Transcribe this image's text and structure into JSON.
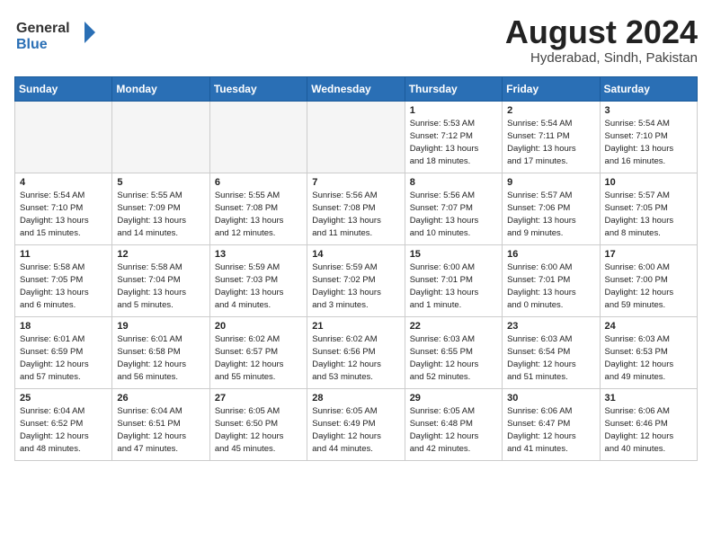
{
  "header": {
    "logo_general": "General",
    "logo_blue": "Blue",
    "month_year": "August 2024",
    "location": "Hyderabad, Sindh, Pakistan"
  },
  "weekdays": [
    "Sunday",
    "Monday",
    "Tuesday",
    "Wednesday",
    "Thursday",
    "Friday",
    "Saturday"
  ],
  "weeks": [
    [
      {
        "day": "",
        "empty": true
      },
      {
        "day": "",
        "empty": true
      },
      {
        "day": "",
        "empty": true
      },
      {
        "day": "",
        "empty": true
      },
      {
        "day": "1",
        "info": "Sunrise: 5:53 AM\nSunset: 7:12 PM\nDaylight: 13 hours\nand 18 minutes."
      },
      {
        "day": "2",
        "info": "Sunrise: 5:54 AM\nSunset: 7:11 PM\nDaylight: 13 hours\nand 17 minutes."
      },
      {
        "day": "3",
        "info": "Sunrise: 5:54 AM\nSunset: 7:10 PM\nDaylight: 13 hours\nand 16 minutes."
      }
    ],
    [
      {
        "day": "4",
        "info": "Sunrise: 5:54 AM\nSunset: 7:10 PM\nDaylight: 13 hours\nand 15 minutes."
      },
      {
        "day": "5",
        "info": "Sunrise: 5:55 AM\nSunset: 7:09 PM\nDaylight: 13 hours\nand 14 minutes."
      },
      {
        "day": "6",
        "info": "Sunrise: 5:55 AM\nSunset: 7:08 PM\nDaylight: 13 hours\nand 12 minutes."
      },
      {
        "day": "7",
        "info": "Sunrise: 5:56 AM\nSunset: 7:08 PM\nDaylight: 13 hours\nand 11 minutes."
      },
      {
        "day": "8",
        "info": "Sunrise: 5:56 AM\nSunset: 7:07 PM\nDaylight: 13 hours\nand 10 minutes."
      },
      {
        "day": "9",
        "info": "Sunrise: 5:57 AM\nSunset: 7:06 PM\nDaylight: 13 hours\nand 9 minutes."
      },
      {
        "day": "10",
        "info": "Sunrise: 5:57 AM\nSunset: 7:05 PM\nDaylight: 13 hours\nand 8 minutes."
      }
    ],
    [
      {
        "day": "11",
        "info": "Sunrise: 5:58 AM\nSunset: 7:05 PM\nDaylight: 13 hours\nand 6 minutes."
      },
      {
        "day": "12",
        "info": "Sunrise: 5:58 AM\nSunset: 7:04 PM\nDaylight: 13 hours\nand 5 minutes."
      },
      {
        "day": "13",
        "info": "Sunrise: 5:59 AM\nSunset: 7:03 PM\nDaylight: 13 hours\nand 4 minutes."
      },
      {
        "day": "14",
        "info": "Sunrise: 5:59 AM\nSunset: 7:02 PM\nDaylight: 13 hours\nand 3 minutes."
      },
      {
        "day": "15",
        "info": "Sunrise: 6:00 AM\nSunset: 7:01 PM\nDaylight: 13 hours\nand 1 minute."
      },
      {
        "day": "16",
        "info": "Sunrise: 6:00 AM\nSunset: 7:01 PM\nDaylight: 13 hours\nand 0 minutes."
      },
      {
        "day": "17",
        "info": "Sunrise: 6:00 AM\nSunset: 7:00 PM\nDaylight: 12 hours\nand 59 minutes."
      }
    ],
    [
      {
        "day": "18",
        "info": "Sunrise: 6:01 AM\nSunset: 6:59 PM\nDaylight: 12 hours\nand 57 minutes."
      },
      {
        "day": "19",
        "info": "Sunrise: 6:01 AM\nSunset: 6:58 PM\nDaylight: 12 hours\nand 56 minutes."
      },
      {
        "day": "20",
        "info": "Sunrise: 6:02 AM\nSunset: 6:57 PM\nDaylight: 12 hours\nand 55 minutes."
      },
      {
        "day": "21",
        "info": "Sunrise: 6:02 AM\nSunset: 6:56 PM\nDaylight: 12 hours\nand 53 minutes."
      },
      {
        "day": "22",
        "info": "Sunrise: 6:03 AM\nSunset: 6:55 PM\nDaylight: 12 hours\nand 52 minutes."
      },
      {
        "day": "23",
        "info": "Sunrise: 6:03 AM\nSunset: 6:54 PM\nDaylight: 12 hours\nand 51 minutes."
      },
      {
        "day": "24",
        "info": "Sunrise: 6:03 AM\nSunset: 6:53 PM\nDaylight: 12 hours\nand 49 minutes."
      }
    ],
    [
      {
        "day": "25",
        "info": "Sunrise: 6:04 AM\nSunset: 6:52 PM\nDaylight: 12 hours\nand 48 minutes."
      },
      {
        "day": "26",
        "info": "Sunrise: 6:04 AM\nSunset: 6:51 PM\nDaylight: 12 hours\nand 47 minutes."
      },
      {
        "day": "27",
        "info": "Sunrise: 6:05 AM\nSunset: 6:50 PM\nDaylight: 12 hours\nand 45 minutes."
      },
      {
        "day": "28",
        "info": "Sunrise: 6:05 AM\nSunset: 6:49 PM\nDaylight: 12 hours\nand 44 minutes."
      },
      {
        "day": "29",
        "info": "Sunrise: 6:05 AM\nSunset: 6:48 PM\nDaylight: 12 hours\nand 42 minutes."
      },
      {
        "day": "30",
        "info": "Sunrise: 6:06 AM\nSunset: 6:47 PM\nDaylight: 12 hours\nand 41 minutes."
      },
      {
        "day": "31",
        "info": "Sunrise: 6:06 AM\nSunset: 6:46 PM\nDaylight: 12 hours\nand 40 minutes."
      }
    ]
  ]
}
